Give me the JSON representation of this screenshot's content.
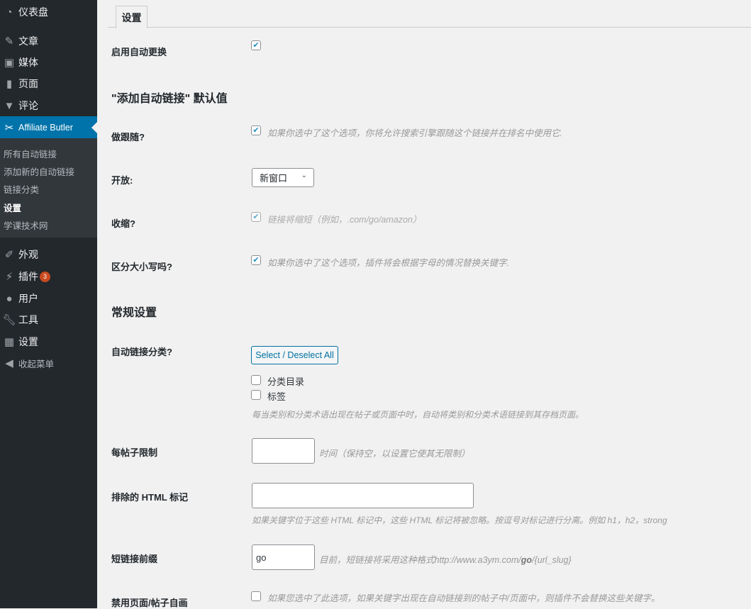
{
  "sidebar": {
    "menu": [
      {
        "label": "仪表盘",
        "icon": "dashboard-icon"
      },
      {
        "label": "文章",
        "icon": "pin-icon"
      },
      {
        "label": "媒体",
        "icon": "media-icon"
      },
      {
        "label": "页面",
        "icon": "pages-icon"
      },
      {
        "label": "评论",
        "icon": "comment-icon"
      },
      {
        "label": "Affiliate Butler",
        "icon": "affiliate-icon"
      },
      {
        "label": "外观",
        "icon": "brush-icon"
      },
      {
        "label": "插件",
        "icon": "plugin-icon",
        "badge": "3"
      },
      {
        "label": "用户",
        "icon": "user-icon"
      },
      {
        "label": "工具",
        "icon": "wrench-icon"
      },
      {
        "label": "设置",
        "icon": "settings-icon"
      },
      {
        "label": "收起菜单",
        "icon": "collapse-icon"
      }
    ],
    "submenu": [
      "所有自动链接",
      "添加新的自动链接",
      "链接分类",
      "设置",
      "学课技术网"
    ]
  },
  "tab": "设置",
  "rows": {
    "enable": {
      "label": "启用自动更换",
      "checked": true
    },
    "section1": "\"添加自动链接\" 默认值",
    "follow": {
      "label": "做跟随?",
      "checked": true,
      "desc": "如果你选中了这个选项，你将允许搜索引擎跟随这个链接并在排名中使用它."
    },
    "open": {
      "label": "开放:",
      "value": "新窗口"
    },
    "shrink": {
      "label": "收缩?",
      "checked": true,
      "desc": "链接将缩短（例如，.com/go/amazon）"
    },
    "case": {
      "label": "区分大小写吗?",
      "checked": true,
      "desc": "如果你选中了这个选项，插件将会根据字母的情况替换关键字."
    },
    "section2": "常规设置",
    "cats": {
      "label": "自动链接分类?",
      "button": "Select / Deselect All",
      "options": [
        "分类目录",
        "标签"
      ],
      "desc": "每当类别和分类术语出现在帖子或页面中时，自动将类别和分类术语链接到其存档页面。"
    },
    "limit": {
      "label": "每帖子限制",
      "value": "",
      "desc": "时间（保持空，以设置它使其无限制）"
    },
    "exclude": {
      "label": "排除的 HTML 标记",
      "value": "",
      "desc": "如果关键字位于这些 HTML 标记中，这些 HTML 标记将被忽略。按逗号对标记进行分离。例如 h1，h2，strong"
    },
    "prefix": {
      "label": "短链接前缀",
      "value": "go",
      "desc_pre": "目前，短链接将采用这种格式http://www.a3ym.com/",
      "desc_bold": "go",
      "desc_post": "/{url_slug}"
    },
    "disable": {
      "label": "禁用页面/帖子自画",
      "checked": false,
      "desc": "如果您选中了此选项，如果关键字出现在自动链接到的帖子中/页面中，则插件不会替换这些关键字。"
    }
  },
  "colors": {
    "sidebar": "#23282d",
    "active": "#0073aa",
    "badge": "#ca4a1f"
  }
}
